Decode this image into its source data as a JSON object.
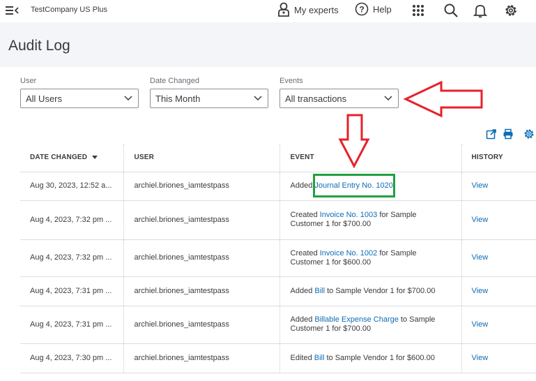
{
  "topbar": {
    "company_name": "TestCompany US Plus",
    "my_experts_label": "My experts",
    "help_label": "Help",
    "icons": [
      "menu-toggle-icon",
      "person-icon",
      "help-icon",
      "apps-grid-icon",
      "search-icon",
      "bell-icon",
      "gear-icon"
    ]
  },
  "page": {
    "title": "Audit Log"
  },
  "filters": {
    "user": {
      "label": "User",
      "value": "All Users"
    },
    "date_changed": {
      "label": "Date Changed",
      "value": "This Month"
    },
    "events": {
      "label": "Events",
      "value": "All transactions"
    }
  },
  "table": {
    "headers": {
      "date": "DATE CHANGED",
      "user": "USER",
      "event": "EVENT",
      "history": "HISTORY"
    },
    "rows": [
      {
        "date": "Aug 30, 2023, 12:52 a...",
        "user": "archiel.briones_iamtestpass",
        "event_pre": "Added ",
        "event_link": "Journal Entry No. 1020",
        "event_post": "",
        "history": "View"
      },
      {
        "date": "Aug 4, 2023, 7:32 pm ...",
        "user": "archiel.briones_iamtestpass",
        "event_pre": "Created ",
        "event_link": "Invoice No. 1003",
        "event_post": " for Sample Customer 1 for $700.00",
        "history": "View"
      },
      {
        "date": "Aug 4, 2023, 7:32 pm ...",
        "user": "archiel.briones_iamtestpass",
        "event_pre": "Created ",
        "event_link": "Invoice No. 1002",
        "event_post": " for Sample Customer 1 for $600.00",
        "history": "View"
      },
      {
        "date": "Aug 4, 2023, 7:31 pm ...",
        "user": "archiel.briones_iamtestpass",
        "event_pre": "Added ",
        "event_link": "Bill",
        "event_post": " to Sample Vendor 1 for $700.00",
        "history": "View"
      },
      {
        "date": "Aug 4, 2023, 7:31 pm ...",
        "user": "archiel.briones_iamtestpass",
        "event_pre": "Added ",
        "event_link": "Billable Expense Charge",
        "event_post": " to Sample Customer 1 for $700.00",
        "history": "View"
      },
      {
        "date": "Aug 4, 2023, 7:30 pm ...",
        "user": "archiel.briones_iamtestpass",
        "event_pre": "Edited ",
        "event_link": "Bill",
        "event_post": " to Sample Vendor 1 for $600.00",
        "history": "View"
      }
    ]
  },
  "colors": {
    "link": "#0e6cb6",
    "annotation_red": "#e8202a",
    "annotation_green": "#21a040",
    "header_band": "#f4f5f8"
  }
}
